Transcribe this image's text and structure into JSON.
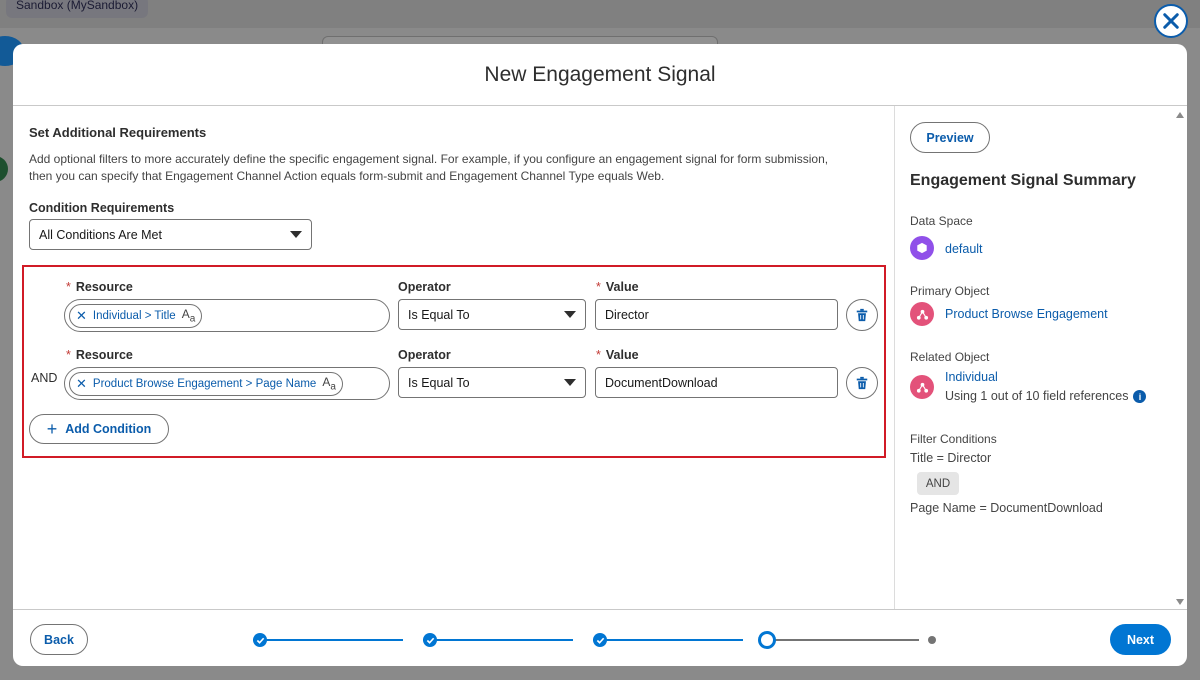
{
  "background": {
    "sandbox_label": "Sandbox (MySandbox)"
  },
  "modal": {
    "title": "New Engagement Signal"
  },
  "requirements": {
    "title": "Set Additional Requirements",
    "description": "Add optional filters to more accurately define the specific engagement signal. For example, if you configure an engagement signal for form submission, then you can specify that Engagement Channel Action equals form-submit and Engagement Channel Type equals Web.",
    "condition_requirements_label": "Condition Requirements",
    "condition_requirements_value": "All Conditions Are Met"
  },
  "conditions": [
    {
      "resource_label": "Resource",
      "operator_label": "Operator",
      "value_label": "Value",
      "resource_pill": "Individual > Title",
      "operator": "Is Equal To",
      "value": "Director"
    },
    {
      "prefix": "AND",
      "resource_label": "Resource",
      "operator_label": "Operator",
      "value_label": "Value",
      "resource_pill": "Product Browse Engagement > Page Name",
      "operator": "Is Equal To",
      "value": "DocumentDownload"
    }
  ],
  "required_mark": "*",
  "type_icon_label": "A",
  "type_icon_sub": "a",
  "add_condition_label": "Add Condition",
  "summary": {
    "preview_label": "Preview",
    "title": "Engagement Signal Summary",
    "data_space_label": "Data Space",
    "data_space_value": "default",
    "primary_object_label": "Primary Object",
    "primary_object_value": "Product Browse Engagement",
    "related_object_label": "Related Object",
    "related_object_value": "Individual",
    "related_object_note": "Using 1 out of 10 field references",
    "filter_conditions_label": "Filter Conditions",
    "filter_1": "Title = Director",
    "filter_join": "AND",
    "filter_2": "Page Name = DocumentDownload"
  },
  "footer": {
    "back_label": "Back",
    "next_label": "Next",
    "progress_steps": [
      "complete",
      "complete",
      "complete",
      "current",
      "incomplete"
    ]
  },
  "colors": {
    "brand": "#0176d3",
    "link": "#0b5cab",
    "highlight_border": "#d11b26",
    "data_space_icon": "#9050e9",
    "object_icon": "#e3527a"
  }
}
